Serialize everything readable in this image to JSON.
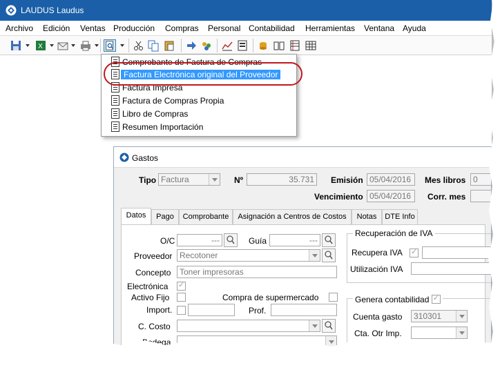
{
  "app": {
    "title": "LAUDUS   Laudus"
  },
  "menu": [
    "Archivo",
    "Edición",
    "Ventas",
    "Producción",
    "Compras",
    "Personal",
    "Contabilidad",
    "Herramientas",
    "Ventana",
    "Ayuda"
  ],
  "dropdown": {
    "items": [
      {
        "label": "Comprobante de Factura de Compras",
        "selected": false
      },
      {
        "label": "Factura Electrónica original del Proveedor",
        "selected": true
      },
      {
        "label": "Factura Impresa",
        "selected": false
      },
      {
        "label": "Factura de Compras Propia",
        "selected": false
      },
      {
        "label": "Libro de Compras",
        "selected": false
      },
      {
        "label": "Resumen Importación",
        "selected": false
      }
    ]
  },
  "gastos": {
    "title": "Gastos",
    "tipo_label": "Tipo",
    "tipo_value": "Factura",
    "numero_label": "Nº",
    "numero_value": "35.731",
    "emision_label": "Emisión",
    "emision_value": "05/04/2016",
    "vencimiento_label": "Vencimiento",
    "vencimiento_value": "05/04/2016",
    "mes_libros_label": "Mes libros",
    "mes_libros_value": "0",
    "corr_mes_label": "Corr. mes",
    "tabs": [
      "Datos",
      "Pago",
      "Comprobante",
      "Asignación a Centros de Costos",
      "Notas",
      "DTE Info"
    ],
    "oc_label": "O/C",
    "oc_value": "---",
    "guia_label": "Guía",
    "guia_value": "---",
    "proveedor_label": "Proveedor",
    "proveedor_value": "Recotoner",
    "concepto_label": "Concepto",
    "concepto_value": "Toner impresoras",
    "electronica_label": "Electrónica",
    "activo_fijo_label": "Activo Fijo",
    "compra_super_label": "Compra de supermercado",
    "import_label": "Import.",
    "prof_label": "Prof.",
    "ccosto_label": "C. Costo",
    "bodega_label": "Bodega",
    "recuperacion_label": "Recuperación de IVA",
    "recupera_iva_label": "Recupera IVA",
    "utilizacion_iva_label": "Utilización IVA",
    "genera_contab_label": "Genera contabilidad",
    "cuenta_gasto_label": "Cuenta gasto",
    "cuenta_gasto_value": "310301",
    "cta_otr_label": "Cta. Otr Imp."
  },
  "colors": {
    "titlebar": "#1a5fa8",
    "highlight": "#3399ff",
    "annotation": "#c0161d"
  }
}
